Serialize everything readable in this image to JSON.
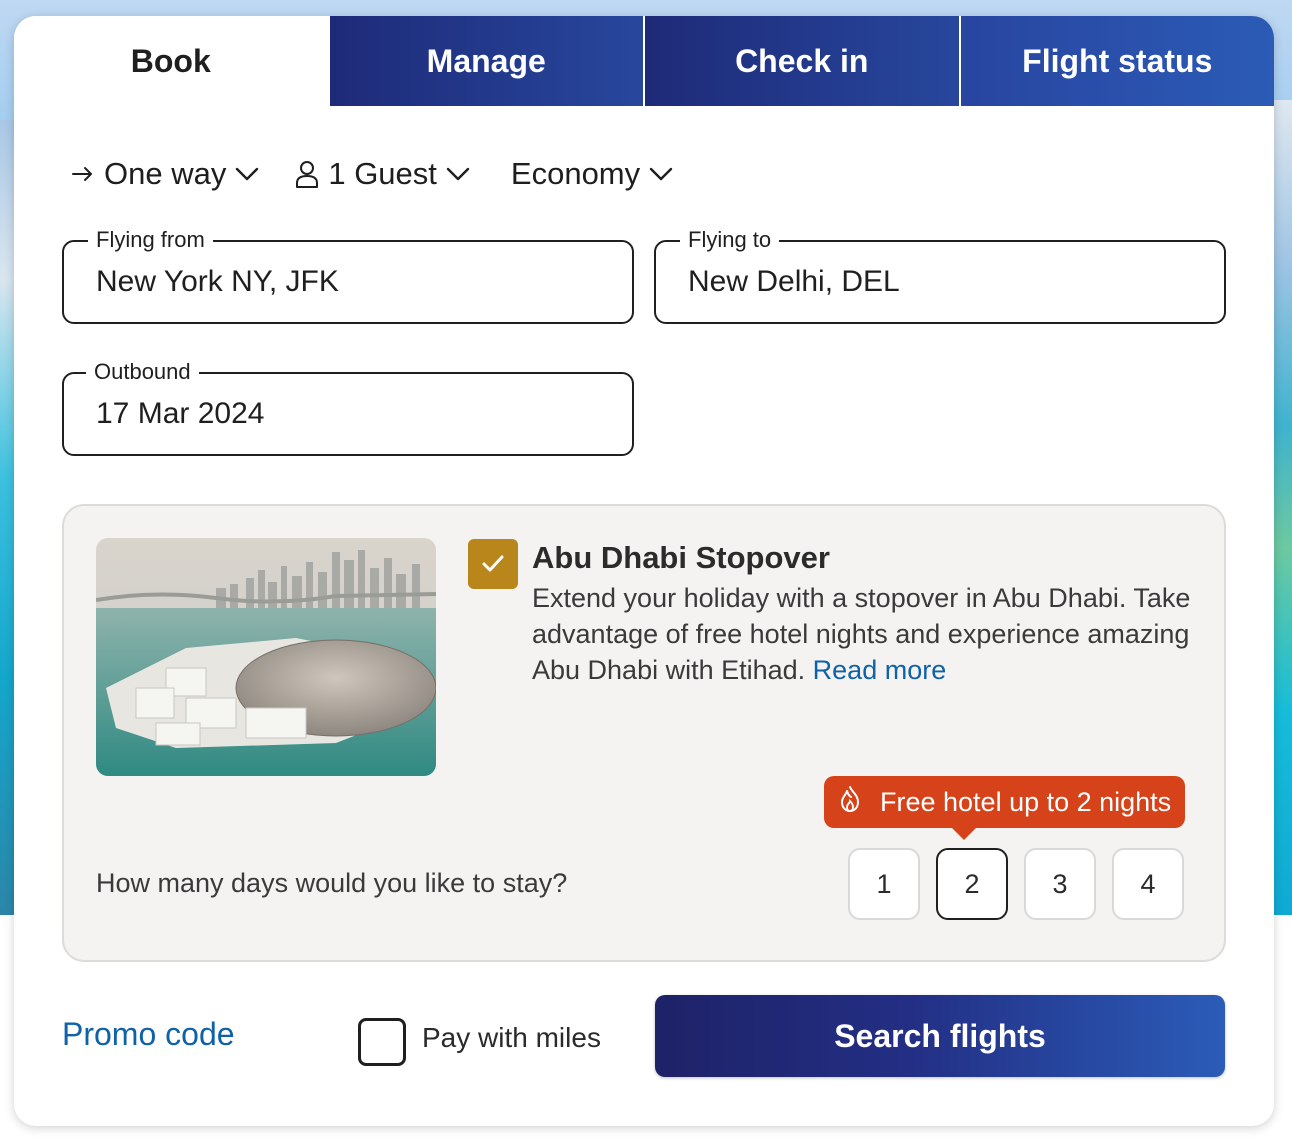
{
  "tabs": [
    {
      "label": "Book",
      "active": true
    },
    {
      "label": "Manage",
      "active": false
    },
    {
      "label": "Check in",
      "active": false
    },
    {
      "label": "Flight status",
      "active": false
    }
  ],
  "options": {
    "trip_type": {
      "label": "One way",
      "icon": "arrow-right-icon"
    },
    "guests": {
      "label": "1 Guest",
      "icon": "person-icon"
    },
    "cabin": {
      "label": "Economy"
    }
  },
  "fields": {
    "from": {
      "label": "Flying from",
      "value": "New York NY, JFK"
    },
    "to": {
      "label": "Flying to",
      "value": "New Delhi, DEL"
    },
    "outbound": {
      "label": "Outbound",
      "value": "17 Mar 2024"
    }
  },
  "stopover": {
    "checked": true,
    "title": "Abu Dhabi Stopover",
    "description": "Extend your holiday with a stopover in Abu Dhabi. Take advantage of free hotel nights and experience amazing Abu Dhabi with Etihad. ",
    "read_more": "Read more",
    "tooltip": "Free hotel up to 2 nights",
    "tooltip_icon": "fire-icon",
    "question": "How many days would you like to stay?",
    "days": [
      "1",
      "2",
      "3",
      "4"
    ],
    "selected_day": "2",
    "image": "abu-dhabi-louvre-photo"
  },
  "footer": {
    "promo": "Promo code",
    "pay_with_miles": "Pay with miles",
    "pay_with_miles_checked": false,
    "search": "Search flights"
  },
  "colors": {
    "tab_blue": "#1e2a78",
    "gold": "#b8861b",
    "orange": "#d6431a",
    "link": "#0f62a8"
  }
}
